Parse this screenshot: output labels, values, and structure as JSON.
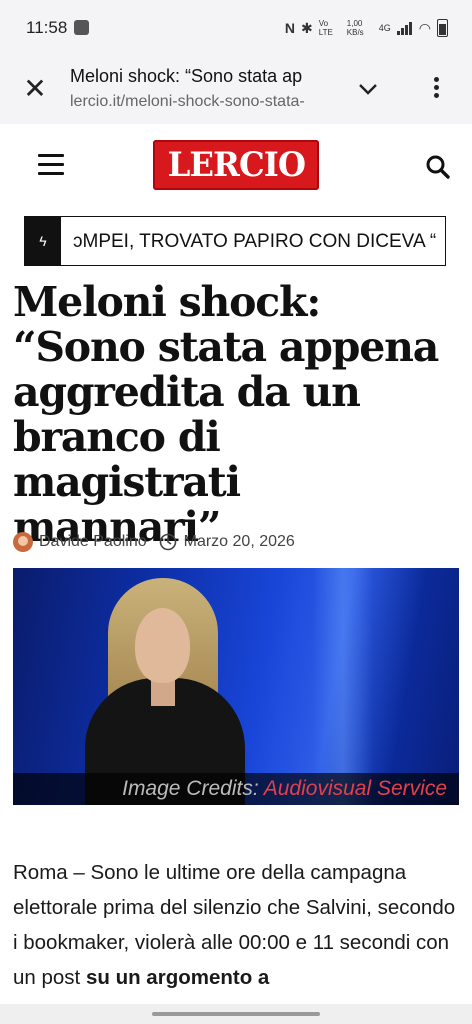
{
  "status_bar": {
    "time": "11:58",
    "nfc": "N",
    "volte": "Vo LTE",
    "speed": "1,00 KB/s",
    "network": "4G"
  },
  "browser": {
    "page_title": "Meloni shock: “Sono stata ap",
    "url": "lercio.it/meloni-shock-sono-stata-"
  },
  "site": {
    "logo_text": "LERCIO",
    "brand_color": "#d7191e"
  },
  "ticker": {
    "text": "ɔMPEI, TROVATO PAPIRO CON DICEVA “"
  },
  "article": {
    "headline": "Meloni shock: “Sono stata appena aggredita da un branco di magistrati mannari”",
    "author": "Davide Paolino",
    "date": "Marzo 20, 2026",
    "image_credit_prefix": "Image Credits:",
    "image_credit_link": "Audiovisual Service",
    "body_start": "Roma – Sono le ultime ore della campagna elettorale prima del silenzio che Salvini, secondo i bookmaker, violerà alle 00:00 e 11 secondi con un post ",
    "body_bold": "su un argomento a"
  }
}
